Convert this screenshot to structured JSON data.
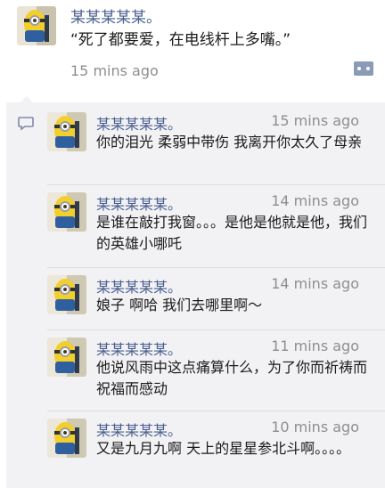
{
  "post": {
    "author": "某某某某某。",
    "text": "“死了都要爱，在电线杆上多嘴。”",
    "time": "15 mins ago"
  },
  "comments": [
    {
      "author": "某某某某某。",
      "time": "15 mins ago",
      "text": "你的泪光 柔弱中带伤 我离开你太久了母亲"
    },
    {
      "author": "某某某某某。",
      "time": "14 mins ago",
      "text": "是谁在敲打我窗。。。是他是他就是他，我们的英雄小哪吒"
    },
    {
      "author": "某某某某某。",
      "time": "14 mins ago",
      "text": "娘子 啊哈 我们去哪里啊～"
    },
    {
      "author": "某某某某某。",
      "time": "11 mins ago",
      "text": "他说风雨中这点痛算什么，为了你而祈祷而祝福而感动"
    },
    {
      "author": "某某某某某。",
      "time": "10 mins ago",
      "text": "又是九月九啊 天上的星星参北斗啊。。。。"
    }
  ],
  "icons": {
    "avatar": "minion-avatar",
    "comment_button": "more-dots-icon",
    "comments_marker": "speech-bubble-icon"
  },
  "colors": {
    "name": "#4a5f8e",
    "time": "#8e8e8e",
    "panel": "#f2f2f5",
    "button": "#8a9bb7"
  }
}
